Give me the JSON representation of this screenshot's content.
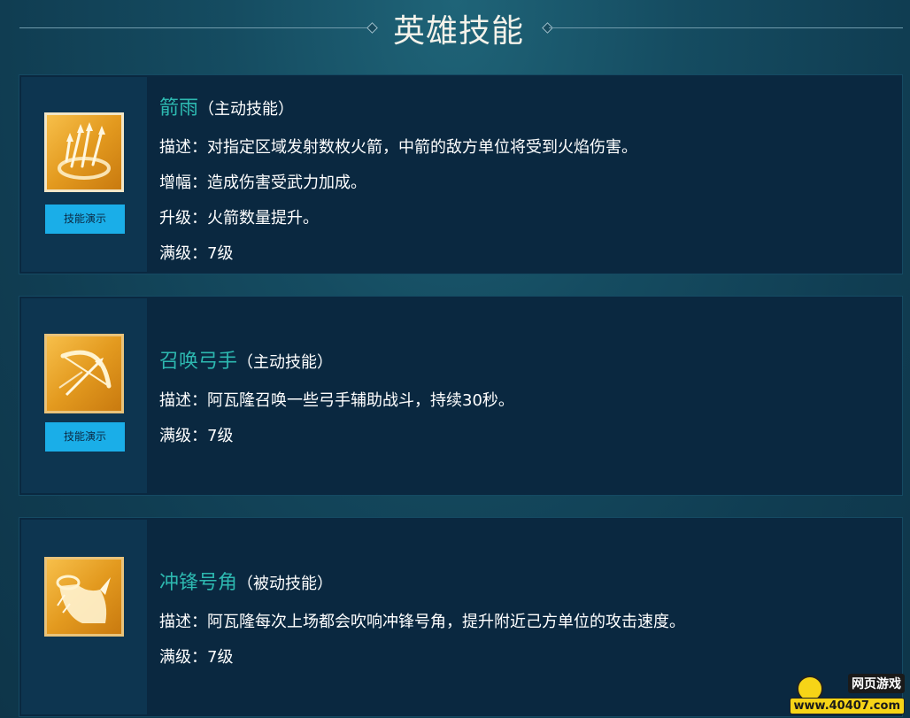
{
  "header": {
    "title": "英雄技能"
  },
  "skills": [
    {
      "name": "箭雨",
      "type": "（主动技能）",
      "icon": "arrow-rain-icon",
      "demo_label": "技能演示",
      "lines": [
        "描述：对指定区域发射数枚火箭，中箭的敌方单位将受到火焰伤害。",
        "增幅：造成伤害受武力加成。",
        "升级：火箭数量提升。",
        "满级：7级"
      ]
    },
    {
      "name": "召唤弓手",
      "type": "（主动技能）",
      "icon": "bow-icon",
      "demo_label": "技能演示",
      "lines": [
        "描述：阿瓦隆召唤一些弓手辅助战斗，持续30秒。",
        "满级：7级"
      ]
    },
    {
      "name": "冲锋号角",
      "type": "（被动技能）",
      "icon": "war-horn-icon",
      "lines": [
        "描述：阿瓦隆每次上场都会吹响冲锋号角，提升附近己方单位的攻击速度。",
        "满级：7级"
      ]
    }
  ],
  "watermark": {
    "top": "网页游戏",
    "bottom": "www.40407.com"
  },
  "colors": {
    "skill_name": "#2db8b0",
    "demo_button": "#1aaee8",
    "card_bg": "#0a2840"
  }
}
